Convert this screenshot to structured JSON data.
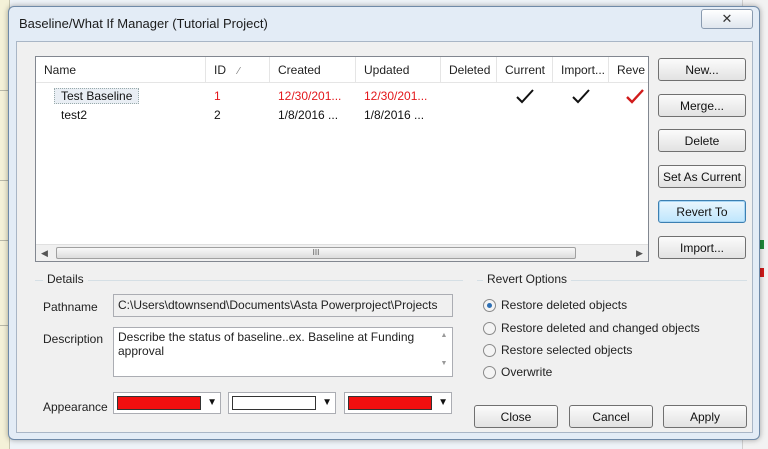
{
  "window": {
    "title": "Baseline/What If Manager (Tutorial Project)"
  },
  "list": {
    "columns": [
      {
        "label": "Name"
      },
      {
        "label": "ID"
      },
      {
        "label": "Created"
      },
      {
        "label": "Updated"
      },
      {
        "label": "Deleted"
      },
      {
        "label": "Current"
      },
      {
        "label": "Import..."
      },
      {
        "label": "Reve"
      }
    ],
    "sort_indicator": "⁄",
    "rows": [
      {
        "name": "Test Baseline",
        "id": "1",
        "created": "12/30/201...",
        "updated": "12/30/201...",
        "deleted": "",
        "current": true,
        "imported": true,
        "reverted": true
      },
      {
        "name": "test2",
        "id": "2",
        "created": "1/8/2016 ...",
        "updated": "1/8/2016 ...",
        "deleted": "",
        "current": false,
        "imported": false,
        "reverted": false
      }
    ],
    "scroll_thumb_label": "III",
    "colors": {
      "highlight": "#e3171b",
      "check_black": "#111111",
      "check_red": "#d11b1b"
    }
  },
  "buttons": {
    "new": "New...",
    "merge": "Merge...",
    "delete": "Delete",
    "set_current": "Set As Current",
    "revert_to": "Revert To",
    "import": "Import...",
    "close": "Close",
    "cancel": "Cancel",
    "apply": "Apply"
  },
  "details": {
    "label": "Details",
    "pathname_label": "Pathname",
    "pathname_value": "C:\\Users\\dtownsend\\Documents\\Asta Powerproject\\Projects",
    "description_label": "Description",
    "description_value": "Describe the status of baseline..ex. Baseline at Funding approval",
    "appearance_label": "Appearance",
    "appearance_colors": [
      "#f20f0f",
      "#ffffff",
      "#f20f0f"
    ]
  },
  "revert_options": {
    "label": "Revert Options",
    "options": [
      {
        "label": "Restore deleted objects",
        "selected": true
      },
      {
        "label": "Restore deleted and changed objects",
        "selected": false
      },
      {
        "label": "Restore selected objects",
        "selected": false
      },
      {
        "label": "Overwrite",
        "selected": false
      }
    ]
  }
}
